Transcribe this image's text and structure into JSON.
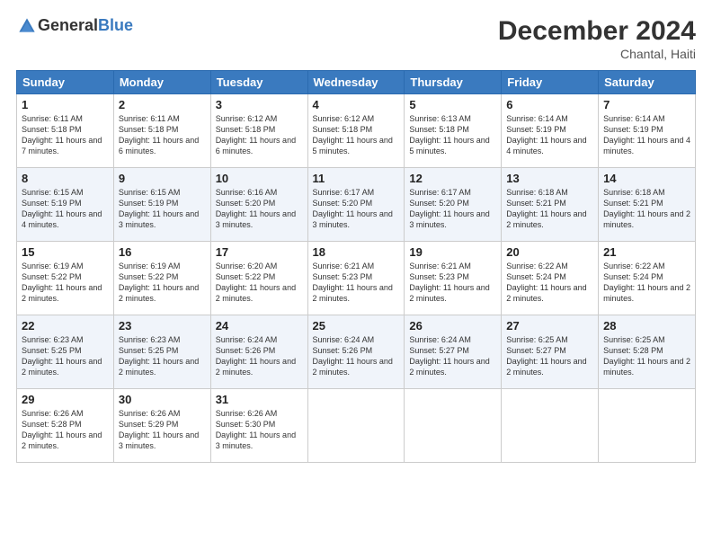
{
  "header": {
    "logo_general": "General",
    "logo_blue": "Blue",
    "month_year": "December 2024",
    "location": "Chantal, Haiti"
  },
  "days_of_week": [
    "Sunday",
    "Monday",
    "Tuesday",
    "Wednesday",
    "Thursday",
    "Friday",
    "Saturday"
  ],
  "weeks": [
    [
      {
        "day": "1",
        "rise": "6:11 AM",
        "set": "5:18 PM",
        "daylight": "11 hours and 7 minutes."
      },
      {
        "day": "2",
        "rise": "6:11 AM",
        "set": "5:18 PM",
        "daylight": "11 hours and 6 minutes."
      },
      {
        "day": "3",
        "rise": "6:12 AM",
        "set": "5:18 PM",
        "daylight": "11 hours and 6 minutes."
      },
      {
        "day": "4",
        "rise": "6:12 AM",
        "set": "5:18 PM",
        "daylight": "11 hours and 5 minutes."
      },
      {
        "day": "5",
        "rise": "6:13 AM",
        "set": "5:18 PM",
        "daylight": "11 hours and 5 minutes."
      },
      {
        "day": "6",
        "rise": "6:14 AM",
        "set": "5:19 PM",
        "daylight": "11 hours and 4 minutes."
      },
      {
        "day": "7",
        "rise": "6:14 AM",
        "set": "5:19 PM",
        "daylight": "11 hours and 4 minutes."
      }
    ],
    [
      {
        "day": "8",
        "rise": "6:15 AM",
        "set": "5:19 PM",
        "daylight": "11 hours and 4 minutes."
      },
      {
        "day": "9",
        "rise": "6:15 AM",
        "set": "5:19 PM",
        "daylight": "11 hours and 3 minutes."
      },
      {
        "day": "10",
        "rise": "6:16 AM",
        "set": "5:20 PM",
        "daylight": "11 hours and 3 minutes."
      },
      {
        "day": "11",
        "rise": "6:17 AM",
        "set": "5:20 PM",
        "daylight": "11 hours and 3 minutes."
      },
      {
        "day": "12",
        "rise": "6:17 AM",
        "set": "5:20 PM",
        "daylight": "11 hours and 3 minutes."
      },
      {
        "day": "13",
        "rise": "6:18 AM",
        "set": "5:21 PM",
        "daylight": "11 hours and 2 minutes."
      },
      {
        "day": "14",
        "rise": "6:18 AM",
        "set": "5:21 PM",
        "daylight": "11 hours and 2 minutes."
      }
    ],
    [
      {
        "day": "15",
        "rise": "6:19 AM",
        "set": "5:22 PM",
        "daylight": "11 hours and 2 minutes."
      },
      {
        "day": "16",
        "rise": "6:19 AM",
        "set": "5:22 PM",
        "daylight": "11 hours and 2 minutes."
      },
      {
        "day": "17",
        "rise": "6:20 AM",
        "set": "5:22 PM",
        "daylight": "11 hours and 2 minutes."
      },
      {
        "day": "18",
        "rise": "6:21 AM",
        "set": "5:23 PM",
        "daylight": "11 hours and 2 minutes."
      },
      {
        "day": "19",
        "rise": "6:21 AM",
        "set": "5:23 PM",
        "daylight": "11 hours and 2 minutes."
      },
      {
        "day": "20",
        "rise": "6:22 AM",
        "set": "5:24 PM",
        "daylight": "11 hours and 2 minutes."
      },
      {
        "day": "21",
        "rise": "6:22 AM",
        "set": "5:24 PM",
        "daylight": "11 hours and 2 minutes."
      }
    ],
    [
      {
        "day": "22",
        "rise": "6:23 AM",
        "set": "5:25 PM",
        "daylight": "11 hours and 2 minutes."
      },
      {
        "day": "23",
        "rise": "6:23 AM",
        "set": "5:25 PM",
        "daylight": "11 hours and 2 minutes."
      },
      {
        "day": "24",
        "rise": "6:24 AM",
        "set": "5:26 PM",
        "daylight": "11 hours and 2 minutes."
      },
      {
        "day": "25",
        "rise": "6:24 AM",
        "set": "5:26 PM",
        "daylight": "11 hours and 2 minutes."
      },
      {
        "day": "26",
        "rise": "6:24 AM",
        "set": "5:27 PM",
        "daylight": "11 hours and 2 minutes."
      },
      {
        "day": "27",
        "rise": "6:25 AM",
        "set": "5:27 PM",
        "daylight": "11 hours and 2 minutes."
      },
      {
        "day": "28",
        "rise": "6:25 AM",
        "set": "5:28 PM",
        "daylight": "11 hours and 2 minutes."
      }
    ],
    [
      {
        "day": "29",
        "rise": "6:26 AM",
        "set": "5:28 PM",
        "daylight": "11 hours and 2 minutes."
      },
      {
        "day": "30",
        "rise": "6:26 AM",
        "set": "5:29 PM",
        "daylight": "11 hours and 3 minutes."
      },
      {
        "day": "31",
        "rise": "6:26 AM",
        "set": "5:30 PM",
        "daylight": "11 hours and 3 minutes."
      },
      null,
      null,
      null,
      null
    ]
  ],
  "sunrise_label": "Sunrise:",
  "sunset_label": "Sunset:",
  "daylight_label": "Daylight:"
}
